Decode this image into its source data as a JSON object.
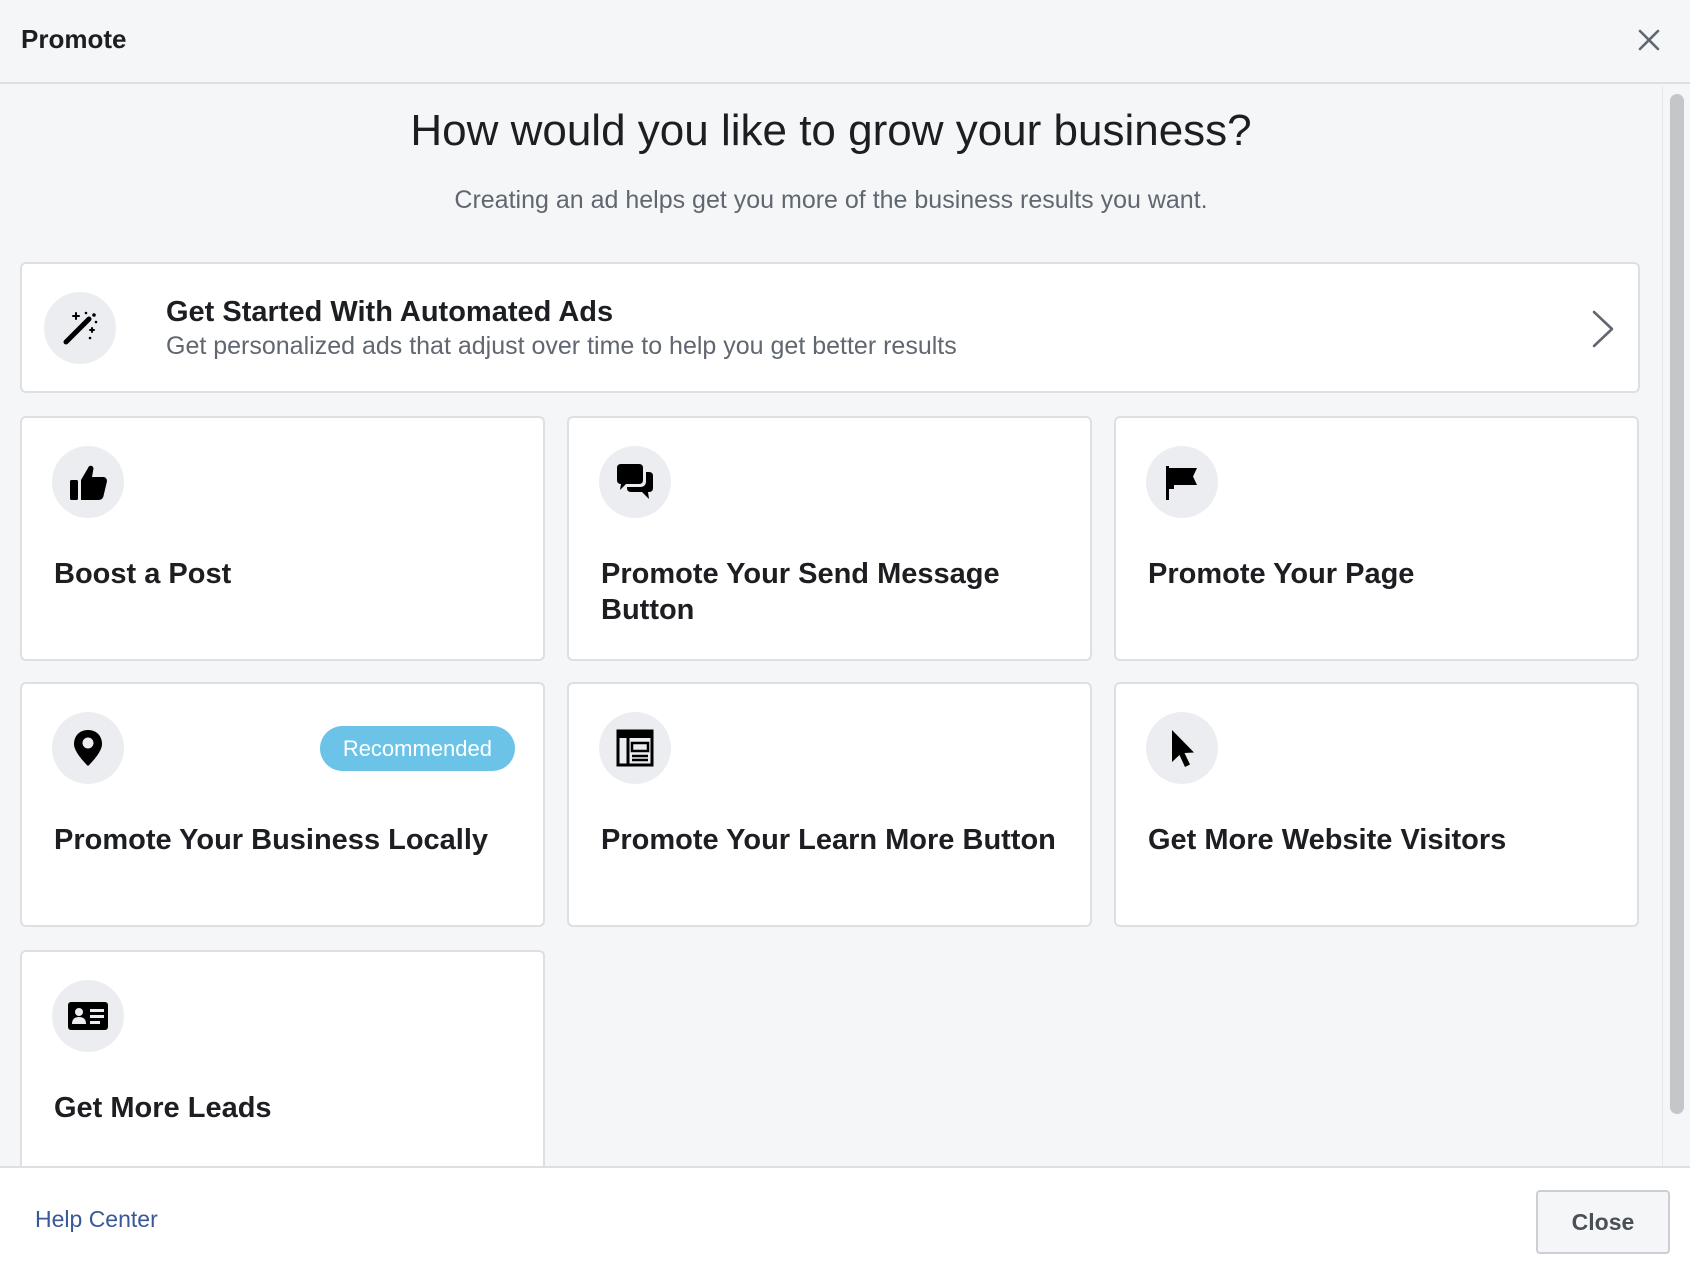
{
  "header": {
    "title": "Promote"
  },
  "main": {
    "heading": "How would you like to grow your business?",
    "subheading": "Creating an ad helps get you more of the business results you want.",
    "automated": {
      "title": "Get Started With Automated Ads",
      "description": "Get personalized ads that adjust over time to help you get better results",
      "icon": "magic-wand-icon"
    },
    "options": [
      {
        "title": "Boost a Post",
        "icon": "thumbs-up-icon"
      },
      {
        "title": "Promote Your Send Message Button",
        "icon": "chat-bubbles-icon"
      },
      {
        "title": "Promote Your Page",
        "icon": "flag-icon"
      },
      {
        "title": "Promote Your Business Locally",
        "icon": "location-pin-icon",
        "badge": "Recommended"
      },
      {
        "title": "Promote Your Learn More Button",
        "icon": "webpage-icon"
      },
      {
        "title": "Get More Website Visitors",
        "icon": "cursor-icon"
      },
      {
        "title": "Get More Leads",
        "icon": "contact-card-icon"
      }
    ]
  },
  "footer": {
    "help_link": "Help Center",
    "close_label": "Close"
  },
  "colors": {
    "badge": "#6bc4e8",
    "link": "#385898",
    "background": "#f5f6f7"
  }
}
